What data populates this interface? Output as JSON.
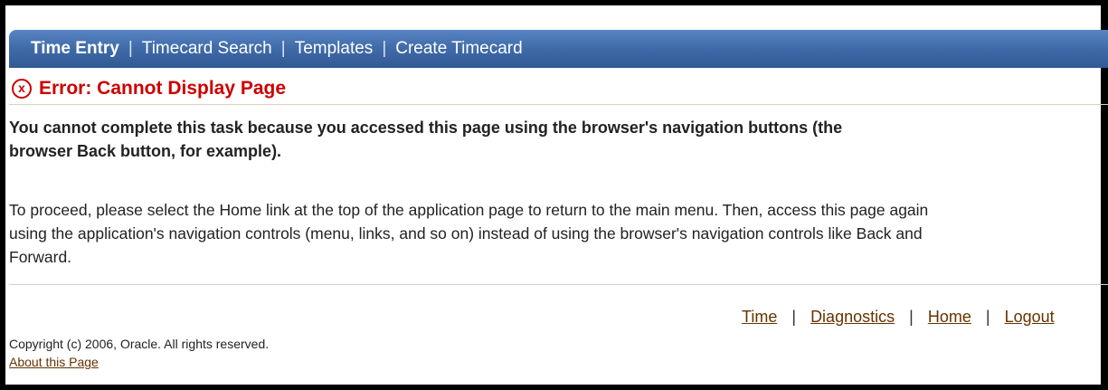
{
  "nav": {
    "tabs": [
      {
        "label": "Time Entry",
        "active": true
      },
      {
        "label": "Timecard Search",
        "active": false
      },
      {
        "label": "Templates",
        "active": false
      },
      {
        "label": "Create Timecard",
        "active": false
      }
    ],
    "separator": "|"
  },
  "error": {
    "icon": "error-x-icon",
    "title": "Error: Cannot Display Page",
    "color": "#cc0000"
  },
  "message": {
    "bold": "You cannot complete this task because you accessed this page using the browser's navigation buttons (the browser Back button, for example).",
    "body": "To proceed, please select the Home link at the top of the application page to return to the main menu. Then, access this page again using the application's navigation controls (menu, links, and so on) instead of using the browser's navigation controls like Back and Forward."
  },
  "footer": {
    "links": [
      "Time",
      "Diagnostics",
      "Home",
      "Logout"
    ],
    "separator": "|",
    "copyright": "Copyright (c) 2006, Oracle. All rights reserved.",
    "about": "About this Page"
  },
  "colors": {
    "nav_bar": "#3f6aa8",
    "link": "#663300"
  }
}
